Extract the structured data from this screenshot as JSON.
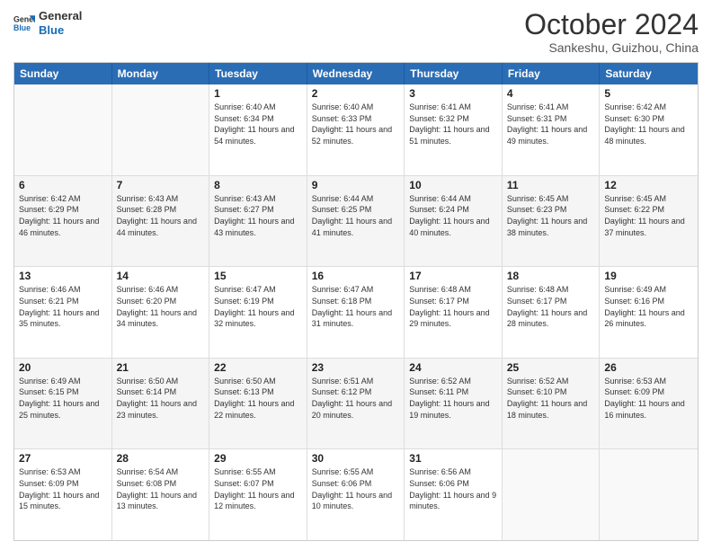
{
  "logo": {
    "line1": "General",
    "line2": "Blue"
  },
  "title": "October 2024",
  "location": "Sankeshu, Guizhou, China",
  "days_of_week": [
    "Sunday",
    "Monday",
    "Tuesday",
    "Wednesday",
    "Thursday",
    "Friday",
    "Saturday"
  ],
  "weeks": [
    [
      {
        "day": "",
        "sunrise": "",
        "sunset": "",
        "daylight": "",
        "empty": true
      },
      {
        "day": "",
        "sunrise": "",
        "sunset": "",
        "daylight": "",
        "empty": true
      },
      {
        "day": "1",
        "sunrise": "Sunrise: 6:40 AM",
        "sunset": "Sunset: 6:34 PM",
        "daylight": "Daylight: 11 hours and 54 minutes."
      },
      {
        "day": "2",
        "sunrise": "Sunrise: 6:40 AM",
        "sunset": "Sunset: 6:33 PM",
        "daylight": "Daylight: 11 hours and 52 minutes."
      },
      {
        "day": "3",
        "sunrise": "Sunrise: 6:41 AM",
        "sunset": "Sunset: 6:32 PM",
        "daylight": "Daylight: 11 hours and 51 minutes."
      },
      {
        "day": "4",
        "sunrise": "Sunrise: 6:41 AM",
        "sunset": "Sunset: 6:31 PM",
        "daylight": "Daylight: 11 hours and 49 minutes."
      },
      {
        "day": "5",
        "sunrise": "Sunrise: 6:42 AM",
        "sunset": "Sunset: 6:30 PM",
        "daylight": "Daylight: 11 hours and 48 minutes."
      }
    ],
    [
      {
        "day": "6",
        "sunrise": "Sunrise: 6:42 AM",
        "sunset": "Sunset: 6:29 PM",
        "daylight": "Daylight: 11 hours and 46 minutes."
      },
      {
        "day": "7",
        "sunrise": "Sunrise: 6:43 AM",
        "sunset": "Sunset: 6:28 PM",
        "daylight": "Daylight: 11 hours and 44 minutes."
      },
      {
        "day": "8",
        "sunrise": "Sunrise: 6:43 AM",
        "sunset": "Sunset: 6:27 PM",
        "daylight": "Daylight: 11 hours and 43 minutes."
      },
      {
        "day": "9",
        "sunrise": "Sunrise: 6:44 AM",
        "sunset": "Sunset: 6:25 PM",
        "daylight": "Daylight: 11 hours and 41 minutes."
      },
      {
        "day": "10",
        "sunrise": "Sunrise: 6:44 AM",
        "sunset": "Sunset: 6:24 PM",
        "daylight": "Daylight: 11 hours and 40 minutes."
      },
      {
        "day": "11",
        "sunrise": "Sunrise: 6:45 AM",
        "sunset": "Sunset: 6:23 PM",
        "daylight": "Daylight: 11 hours and 38 minutes."
      },
      {
        "day": "12",
        "sunrise": "Sunrise: 6:45 AM",
        "sunset": "Sunset: 6:22 PM",
        "daylight": "Daylight: 11 hours and 37 minutes."
      }
    ],
    [
      {
        "day": "13",
        "sunrise": "Sunrise: 6:46 AM",
        "sunset": "Sunset: 6:21 PM",
        "daylight": "Daylight: 11 hours and 35 minutes."
      },
      {
        "day": "14",
        "sunrise": "Sunrise: 6:46 AM",
        "sunset": "Sunset: 6:20 PM",
        "daylight": "Daylight: 11 hours and 34 minutes."
      },
      {
        "day": "15",
        "sunrise": "Sunrise: 6:47 AM",
        "sunset": "Sunset: 6:19 PM",
        "daylight": "Daylight: 11 hours and 32 minutes."
      },
      {
        "day": "16",
        "sunrise": "Sunrise: 6:47 AM",
        "sunset": "Sunset: 6:18 PM",
        "daylight": "Daylight: 11 hours and 31 minutes."
      },
      {
        "day": "17",
        "sunrise": "Sunrise: 6:48 AM",
        "sunset": "Sunset: 6:17 PM",
        "daylight": "Daylight: 11 hours and 29 minutes."
      },
      {
        "day": "18",
        "sunrise": "Sunrise: 6:48 AM",
        "sunset": "Sunset: 6:17 PM",
        "daylight": "Daylight: 11 hours and 28 minutes."
      },
      {
        "day": "19",
        "sunrise": "Sunrise: 6:49 AM",
        "sunset": "Sunset: 6:16 PM",
        "daylight": "Daylight: 11 hours and 26 minutes."
      }
    ],
    [
      {
        "day": "20",
        "sunrise": "Sunrise: 6:49 AM",
        "sunset": "Sunset: 6:15 PM",
        "daylight": "Daylight: 11 hours and 25 minutes."
      },
      {
        "day": "21",
        "sunrise": "Sunrise: 6:50 AM",
        "sunset": "Sunset: 6:14 PM",
        "daylight": "Daylight: 11 hours and 23 minutes."
      },
      {
        "day": "22",
        "sunrise": "Sunrise: 6:50 AM",
        "sunset": "Sunset: 6:13 PM",
        "daylight": "Daylight: 11 hours and 22 minutes."
      },
      {
        "day": "23",
        "sunrise": "Sunrise: 6:51 AM",
        "sunset": "Sunset: 6:12 PM",
        "daylight": "Daylight: 11 hours and 20 minutes."
      },
      {
        "day": "24",
        "sunrise": "Sunrise: 6:52 AM",
        "sunset": "Sunset: 6:11 PM",
        "daylight": "Daylight: 11 hours and 19 minutes."
      },
      {
        "day": "25",
        "sunrise": "Sunrise: 6:52 AM",
        "sunset": "Sunset: 6:10 PM",
        "daylight": "Daylight: 11 hours and 18 minutes."
      },
      {
        "day": "26",
        "sunrise": "Sunrise: 6:53 AM",
        "sunset": "Sunset: 6:09 PM",
        "daylight": "Daylight: 11 hours and 16 minutes."
      }
    ],
    [
      {
        "day": "27",
        "sunrise": "Sunrise: 6:53 AM",
        "sunset": "Sunset: 6:09 PM",
        "daylight": "Daylight: 11 hours and 15 minutes."
      },
      {
        "day": "28",
        "sunrise": "Sunrise: 6:54 AM",
        "sunset": "Sunset: 6:08 PM",
        "daylight": "Daylight: 11 hours and 13 minutes."
      },
      {
        "day": "29",
        "sunrise": "Sunrise: 6:55 AM",
        "sunset": "Sunset: 6:07 PM",
        "daylight": "Daylight: 11 hours and 12 minutes."
      },
      {
        "day": "30",
        "sunrise": "Sunrise: 6:55 AM",
        "sunset": "Sunset: 6:06 PM",
        "daylight": "Daylight: 11 hours and 10 minutes."
      },
      {
        "day": "31",
        "sunrise": "Sunrise: 6:56 AM",
        "sunset": "Sunset: 6:06 PM",
        "daylight": "Daylight: 11 hours and 9 minutes."
      },
      {
        "day": "",
        "sunrise": "",
        "sunset": "",
        "daylight": "",
        "empty": true
      },
      {
        "day": "",
        "sunrise": "",
        "sunset": "",
        "daylight": "",
        "empty": true
      }
    ]
  ]
}
